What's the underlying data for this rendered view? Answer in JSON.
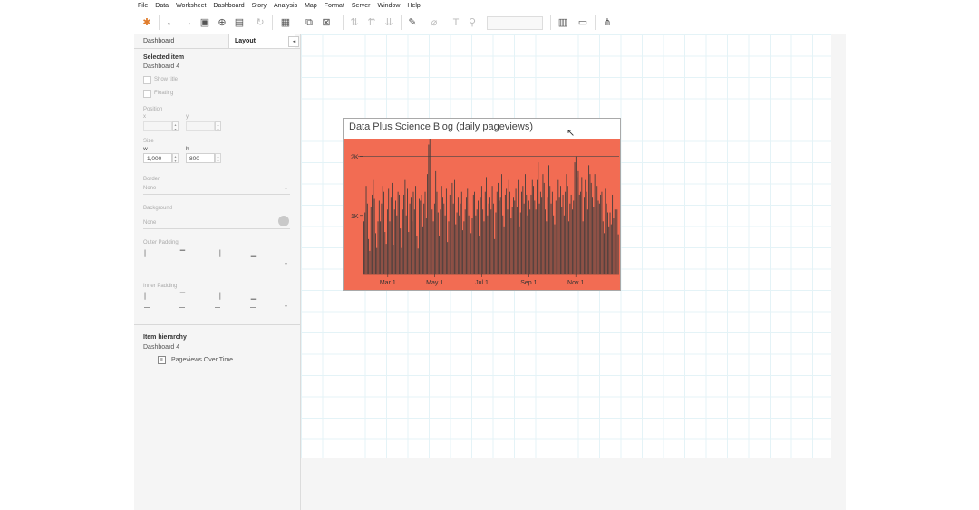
{
  "menu": [
    "File",
    "Data",
    "Worksheet",
    "Dashboard",
    "Story",
    "Analysis",
    "Map",
    "Format",
    "Server",
    "Window",
    "Help"
  ],
  "panel": {
    "tab_dashboard": "Dashboard",
    "tab_layout": "Layout",
    "collapse_glyph": "◂",
    "selected_item_heading": "Selected item",
    "selected_item_value": "Dashboard 4",
    "show_title": "Show title",
    "floating": "Floating",
    "position_label": "Position",
    "x_label": "x",
    "y_label": "y",
    "size_label": "Size",
    "w_label": "w",
    "h_label": "h",
    "w_value": "1,000",
    "h_value": "800",
    "border_label": "Border",
    "border_value": "None",
    "background_label": "Background",
    "background_value": "None",
    "outer_padding_label": "Outer Padding",
    "inner_padding_label": "Inner Padding",
    "hierarchy_heading": "Item hierarchy",
    "hierarchy_root": "Dashboard 4",
    "hierarchy_child": "Pageviews Over Time"
  },
  "viz": {
    "title": "Data Plus Science Blog (daily pageviews)"
  },
  "colors": {
    "chart_background": "#f26c53",
    "bars": "#3b3b3b",
    "canvas_grid": "#e4f3f7"
  },
  "chart_data": {
    "type": "bar",
    "title": "Data Plus Science Blog (daily pageviews)",
    "x_tick_labels": [
      "Mar 1",
      "May 1",
      "Jul 1",
      "Sep 1",
      "Nov 1"
    ],
    "y_tick_labels": [
      "1K",
      "2K"
    ],
    "y_ticks": [
      1000,
      2000
    ],
    "ylim": [
      0,
      2300
    ],
    "reference_lines": [
      2000
    ],
    "series": [
      {
        "values": [
          900,
          1050,
          1500,
          1200,
          600,
          400,
          1150,
          1350,
          1600,
          1280,
          700,
          450,
          900,
          1250,
          900,
          1200,
          1500,
          1400,
          720,
          520,
          1100,
          1450,
          900,
          1300,
          1550,
          500,
          1100,
          1250,
          1000,
          1400,
          1350,
          780,
          450,
          1100,
          1350,
          1600,
          1000,
          1450,
          720,
          1200,
          1300,
          900,
          1400,
          1100,
          1500,
          650,
          440,
          1280,
          1250,
          1350,
          800,
          1200,
          1400,
          950,
          1700,
          2200,
          2350,
          1600,
          1100,
          900,
          1200,
          1750,
          1400,
          1050,
          650,
          1100,
          1500,
          1300,
          1200,
          1000,
          1450,
          550,
          900,
          1350,
          1100,
          1550,
          1200,
          1600,
          850,
          1050,
          1300,
          1000,
          1200,
          1400,
          750,
          900,
          1100,
          1300,
          1450,
          1000,
          1200,
          700,
          950,
          1350,
          1400,
          1000,
          1100,
          1250,
          650,
          1300,
          1500,
          1100,
          900,
          1400,
          1650,
          1000,
          1200,
          1300,
          1100,
          1500,
          1200,
          600,
          1050,
          1400,
          1550,
          1250,
          1300,
          1700,
          1000,
          800,
          1350,
          1450,
          1100,
          1600,
          1400,
          950,
          1150,
          1300,
          1250,
          1450,
          1150,
          1600,
          800,
          1050,
          1400,
          1500,
          1200,
          1700,
          1350,
          1000,
          1250,
          1100,
          1350,
          1600,
          1500,
          1250,
          1100,
          1600,
          1900,
          1200,
          1400,
          1300,
          1700,
          1550,
          1100,
          900,
          1300,
          1850,
          1500,
          1200,
          1400,
          1000,
          850,
          1250,
          1700,
          1600,
          1300,
          1500,
          1150,
          1350,
          1000,
          1400,
          1700,
          1500,
          900,
          1200,
          1350,
          1100,
          1250,
          1900,
          2000,
          1650,
          1750,
          1350,
          1400,
          1650,
          900,
          1300,
          1600,
          1400,
          1100,
          1850,
          1700,
          1550,
          1300,
          1150,
          1700,
          1350,
          1500,
          1250,
          1200,
          1350,
          1400,
          900,
          700,
          1450,
          1200,
          1050,
          800,
          1050,
          850,
          1350,
          950,
          1100,
          700,
          1100,
          680
        ]
      }
    ]
  }
}
